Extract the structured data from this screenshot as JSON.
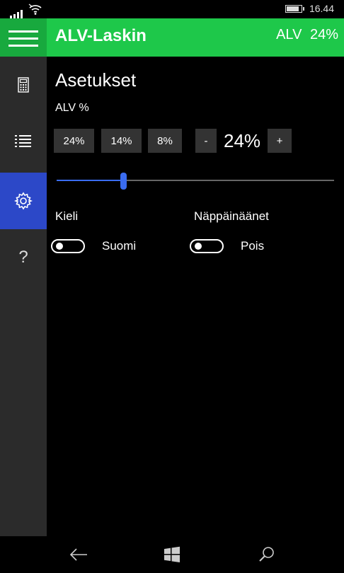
{
  "status_bar": {
    "time": "16.44"
  },
  "header": {
    "app_title": "ALV-Laskin",
    "vat_display": "ALV 24%"
  },
  "sidebar": {
    "items": [
      {
        "icon": "calculator-icon"
      },
      {
        "icon": "list-icon"
      },
      {
        "icon": "gear-icon",
        "active": true
      },
      {
        "icon": "help-icon",
        "label": "?"
      }
    ]
  },
  "settings": {
    "title": "Asetukset",
    "vat_label": "ALV %",
    "presets": [
      "24%",
      "14%",
      "8%"
    ],
    "decrement_label": "-",
    "increment_label": "+",
    "current_vat": "24%",
    "slider_level": 0.24,
    "language": {
      "label": "Kieli",
      "state": "Suomi"
    },
    "keypad_sounds": {
      "label": "Näppäinäänet",
      "state": "Pois"
    }
  },
  "colors": {
    "accent": "#1ec84a",
    "accent_dark": "#18a93e",
    "selection": "#2c48c8",
    "slider": "#3a6cf0"
  }
}
